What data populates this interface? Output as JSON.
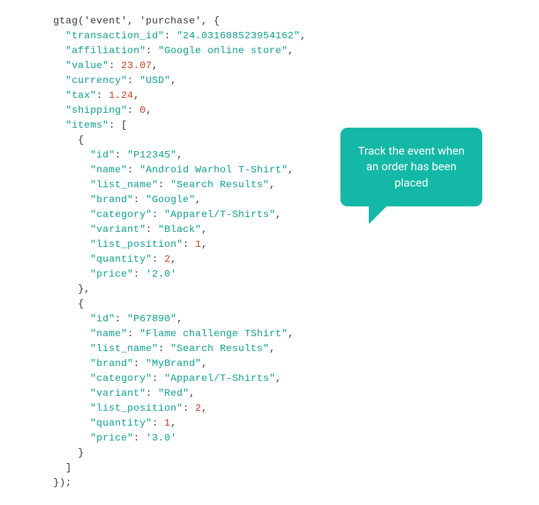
{
  "callout_text": "Track the event when an order has been placed",
  "code": {
    "fn": "gtag",
    "arg1": "'event'",
    "arg2": "'purchase'",
    "keys": {
      "transaction_id": "\"transaction_id\"",
      "affiliation": "\"affiliation\"",
      "value": "\"value\"",
      "currency": "\"currency\"",
      "tax": "\"tax\"",
      "shipping": "\"shipping\"",
      "items": "\"items\"",
      "id": "\"id\"",
      "name": "\"name\"",
      "list_name": "\"list_name\"",
      "brand": "\"brand\"",
      "category": "\"category\"",
      "variant": "\"variant\"",
      "list_position": "\"list_position\"",
      "quantity": "\"quantity\"",
      "price": "\"price\""
    },
    "vals": {
      "transaction_id": "\"24.031608523954162\"",
      "affiliation": "\"Google online store\"",
      "value": "23.07",
      "currency": "\"USD\"",
      "tax": "1.24",
      "shipping": "0",
      "item1": {
        "id": "\"P12345\"",
        "name": "\"Android Warhol T-Shirt\"",
        "list_name": "\"Search Results\"",
        "brand": "\"Google\"",
        "category": "\"Apparel/T-Shirts\"",
        "variant": "\"Black\"",
        "list_position": "1",
        "quantity": "2",
        "price": "'2.0'"
      },
      "item2": {
        "id": "\"P67890\"",
        "name": "\"Flame challenge TShirt\"",
        "list_name": "\"Search Results\"",
        "brand": "\"MyBrand\"",
        "category": "\"Apparel/T-Shirts\"",
        "variant": "\"Red\"",
        "list_position": "2",
        "quantity": "1",
        "price": "'3.0'"
      }
    }
  }
}
